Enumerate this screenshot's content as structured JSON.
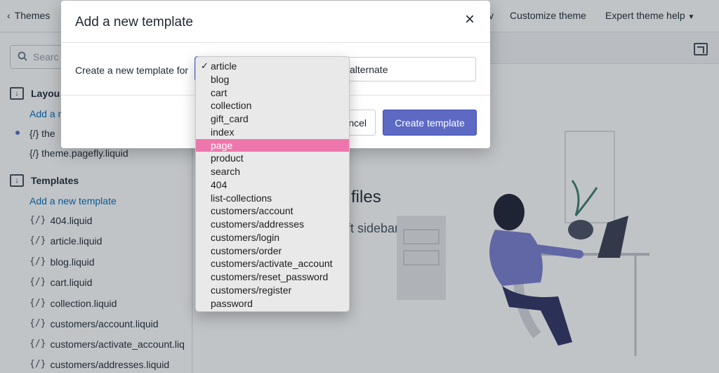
{
  "topbar": {
    "back_label": "Themes",
    "customize_label": "Customize theme",
    "help_label": "Expert theme help",
    "partial_label": "v"
  },
  "sidebar": {
    "search_placeholder": "Searc",
    "layout_heading": "Layou",
    "layout_add": "Add a n",
    "layout_files": [
      "{/} the",
      "{/} theme.pagefly.liquid"
    ],
    "templates_heading": "Templates",
    "templates_add": "Add a new template",
    "template_files": [
      "404.liquid",
      "article.liquid",
      "blog.liquid",
      "cart.liquid",
      "collection.liquid",
      "customers/account.liquid",
      "customers/activate_account.liq",
      "customers/addresses.liquid"
    ],
    "file_icon": "{/}"
  },
  "main": {
    "empty_title": "e files",
    "empty_desc": "left sidebar to"
  },
  "modal": {
    "title": "Add a new template",
    "close_icon": "×",
    "label": "Create a new template for",
    "suffix_value": "alternate",
    "cancel_label": "ncel",
    "create_label": "Create template"
  },
  "dropdown": {
    "options": [
      "article",
      "blog",
      "cart",
      "collection",
      "gift_card",
      "index",
      "page",
      "product",
      "search",
      "404",
      "list-collections",
      "customers/account",
      "customers/addresses",
      "customers/login",
      "customers/order",
      "customers/activate_account",
      "customers/reset_password",
      "customers/register",
      "password"
    ],
    "checked": "article",
    "highlighted": "page",
    "check_icon": "✓"
  },
  "colors": {
    "accent": "#5c6ac4",
    "link": "#006fbb",
    "highlight": "#ed77ad"
  }
}
